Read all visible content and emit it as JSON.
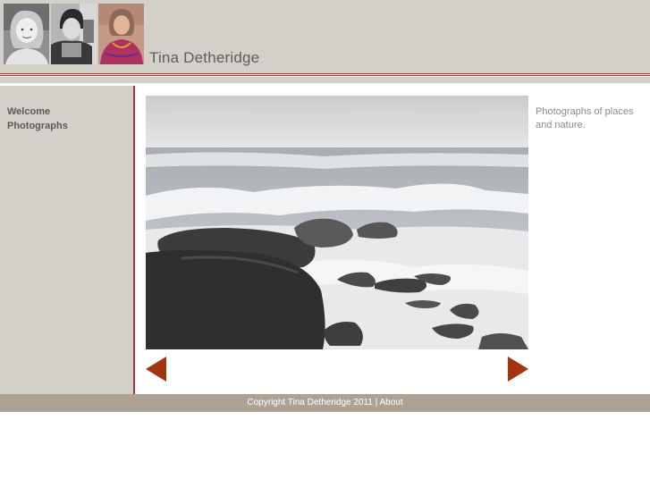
{
  "header": {
    "site_title": "Tina Detheridge",
    "portraits": [
      "child-portrait",
      "young-adult-portrait",
      "adult-portrait"
    ]
  },
  "nav": {
    "items": [
      {
        "label": "Welcome"
      },
      {
        "label": "Photographs"
      }
    ]
  },
  "main": {
    "image_subject": "waves breaking over rocks on a beach",
    "caption": "Photographs of places and nature."
  },
  "gallery": {
    "prev_icon": "left-triangle-arrow",
    "next_icon": "right-triangle-arrow"
  },
  "footer": {
    "copyright": "Copyright Tina Detheridge 2011",
    "separator": " | ",
    "about_label": "About"
  },
  "colors": {
    "header_bg": "#d3cfc9",
    "accent_red": "#a33b34",
    "footer_bg": "#aca395",
    "arrow": "#a33410"
  }
}
